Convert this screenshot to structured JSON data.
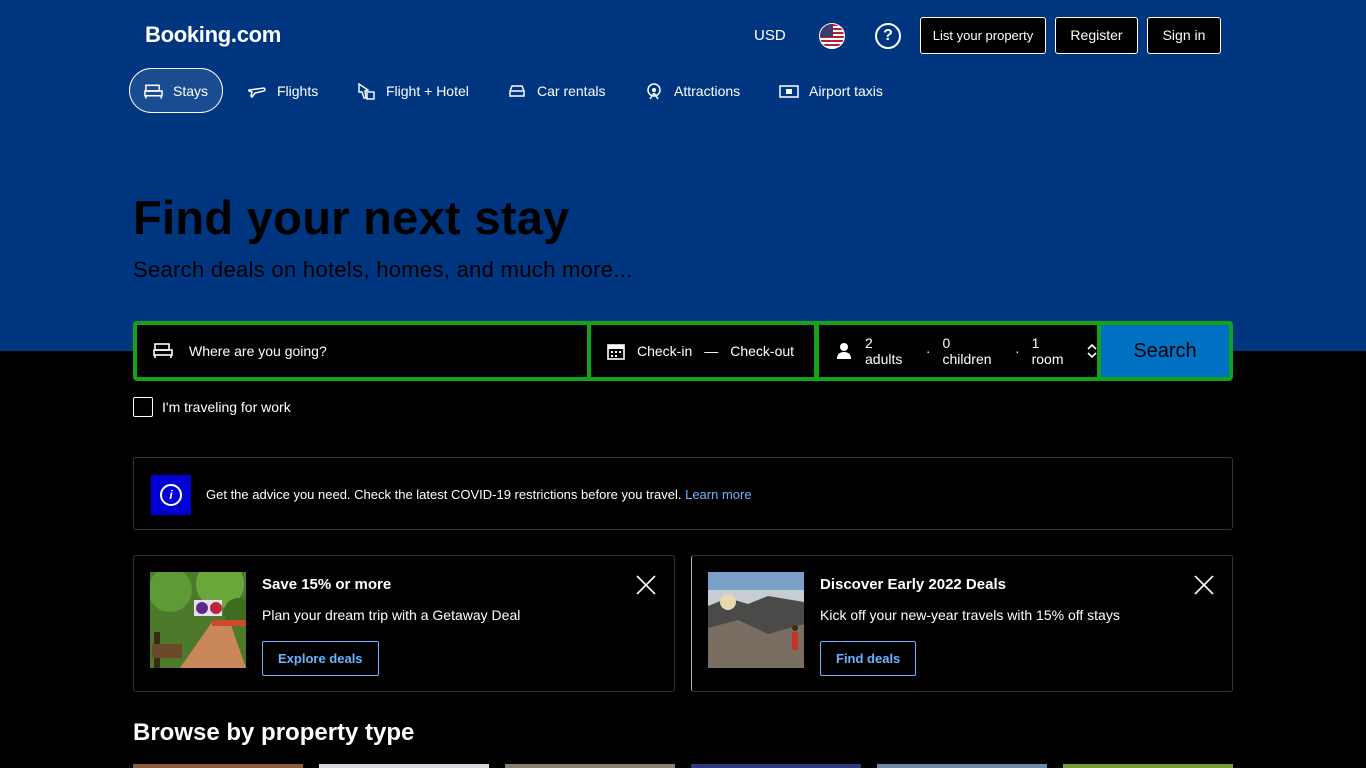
{
  "header": {
    "logo": "Booking.com",
    "currency": "USD",
    "help_icon": "?",
    "list_property": "List your property",
    "register": "Register",
    "sign_in": "Sign in"
  },
  "nav": {
    "tabs": [
      {
        "label": "Stays",
        "icon": "bed-icon",
        "active": true
      },
      {
        "label": "Flights",
        "icon": "plane-icon"
      },
      {
        "label": "Flight + Hotel",
        "icon": "flight-hotel-icon"
      },
      {
        "label": "Car rentals",
        "icon": "car-icon"
      },
      {
        "label": "Attractions",
        "icon": "attractions-icon"
      },
      {
        "label": "Airport taxis",
        "icon": "taxi-icon"
      }
    ]
  },
  "hero": {
    "title": "Find your next stay",
    "subtitle": "Search deals on hotels, homes, and much more..."
  },
  "search": {
    "destination_placeholder": "Where are you going?",
    "checkin": "Check-in",
    "dash": "—",
    "checkout": "Check-out",
    "adults": "2 adults",
    "children": "0 children",
    "rooms": "1 room",
    "sep": "·",
    "button": "Search",
    "work_label": "I'm traveling for work"
  },
  "banner": {
    "text": "Get the advice you need. Check the latest COVID-19 restrictions before you travel.",
    "link": "Learn more"
  },
  "promos": [
    {
      "title": "Save 15% or more",
      "desc": "Plan your dream trip with a Getaway Deal",
      "button": "Explore deals"
    },
    {
      "title": "Discover Early 2022 Deals",
      "desc": "Kick off your new-year travels with 15% off stays",
      "button": "Find deals"
    }
  ],
  "browse": {
    "title": "Browse by property type"
  },
  "colors": {
    "brand_blue": "#003580",
    "search_outline": "#12a31b",
    "search_button": "#0071c2",
    "link_blue": "#6ab3ff"
  }
}
